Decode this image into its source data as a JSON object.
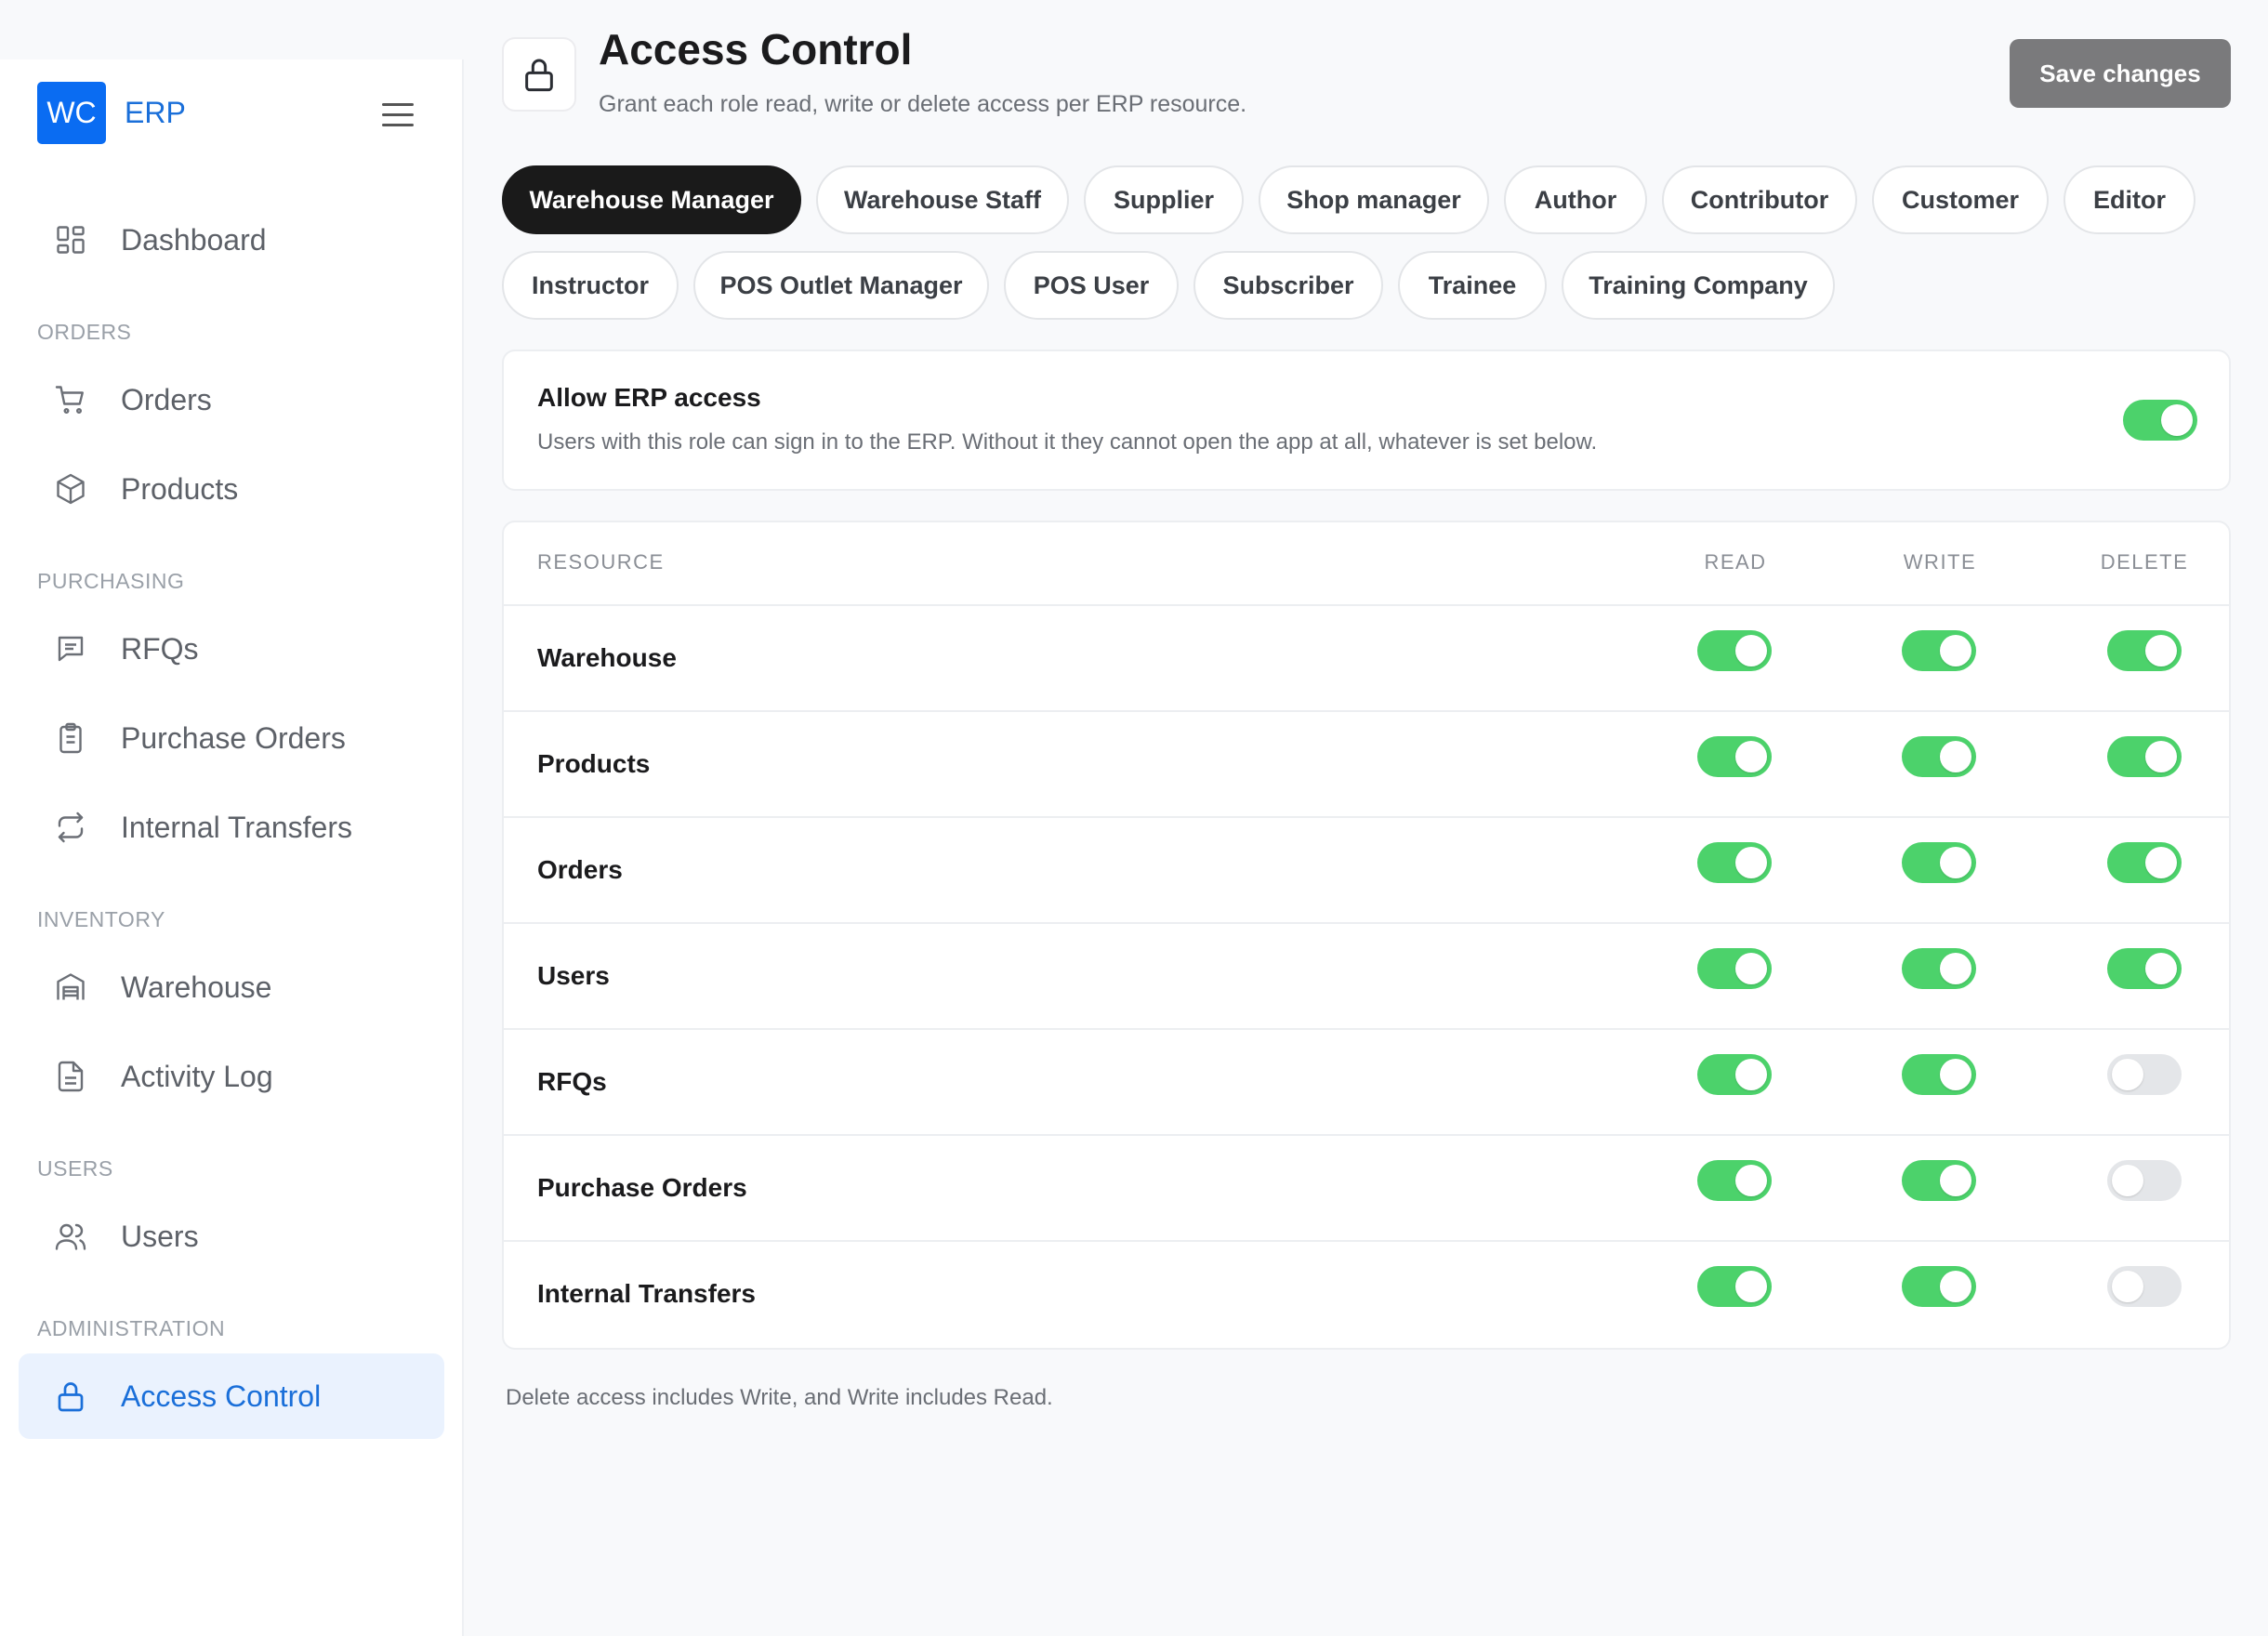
{
  "brand": {
    "logo": "WC",
    "name": "ERP"
  },
  "sidebar": {
    "dashboard": "Dashboard",
    "sections": {
      "orders": "ORDERS",
      "purchasing": "PURCHASING",
      "inventory": "INVENTORY",
      "users": "USERS",
      "administration": "ADMINISTRATION"
    },
    "items": {
      "orders": "Orders",
      "products": "Products",
      "rfqs": "RFQs",
      "purchase_orders": "Purchase Orders",
      "internal_transfers": "Internal Transfers",
      "warehouse": "Warehouse",
      "activity_log": "Activity Log",
      "users": "Users",
      "access_control": "Access Control"
    }
  },
  "header": {
    "title": "Access Control",
    "subtitle": "Grant each role read, write or delete access per ERP resource.",
    "save_label": "Save changes"
  },
  "roles": [
    "Warehouse Manager",
    "Warehouse Staff",
    "Supplier",
    "Shop manager",
    "Author",
    "Contributor",
    "Customer",
    "Editor",
    "Instructor",
    "POS Outlet Manager",
    "POS User",
    "Subscriber",
    "Trainee",
    "Training Company"
  ],
  "selected_role": "Warehouse Manager",
  "erp_access": {
    "title": "Allow ERP access",
    "description": "Users with this role can sign in to the ERP. Without it they cannot open the app at all, whatever is set below.",
    "enabled": true
  },
  "table": {
    "headers": {
      "resource": "RESOURCE",
      "read": "READ",
      "write": "WRITE",
      "delete": "DELETE"
    },
    "rows": [
      {
        "resource": "Warehouse",
        "read": true,
        "write": true,
        "delete": true
      },
      {
        "resource": "Products",
        "read": true,
        "write": true,
        "delete": true
      },
      {
        "resource": "Orders",
        "read": true,
        "write": true,
        "delete": true
      },
      {
        "resource": "Users",
        "read": true,
        "write": true,
        "delete": true
      },
      {
        "resource": "RFQs",
        "read": true,
        "write": true,
        "delete": false
      },
      {
        "resource": "Purchase Orders",
        "read": true,
        "write": true,
        "delete": false
      },
      {
        "resource": "Internal Transfers",
        "read": true,
        "write": true,
        "delete": false
      }
    ]
  },
  "footnote": "Delete access includes Write, and Write includes Read.",
  "colors": {
    "accent": "#1a6fd9",
    "toggle_on": "#4cd26b",
    "toggle_off": "#e4e6e9",
    "logo_bg": "#0a6cf2"
  }
}
